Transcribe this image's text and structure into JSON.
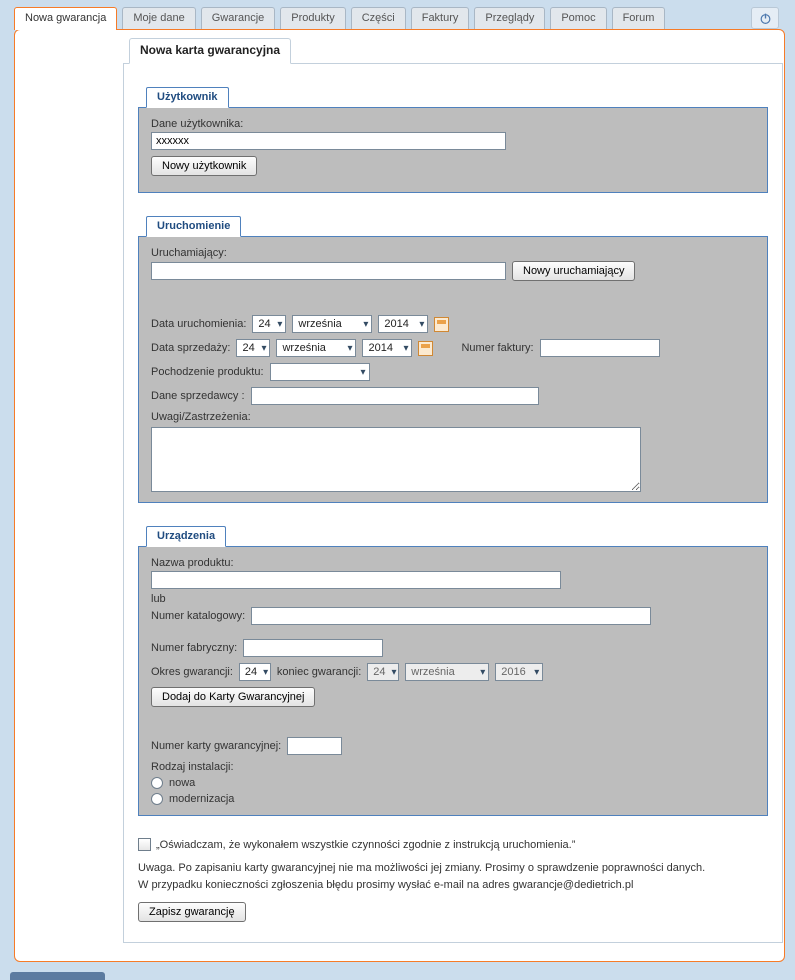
{
  "tabs": [
    {
      "label": "Nowa gwarancja"
    },
    {
      "label": "Moje dane"
    },
    {
      "label": "Gwarancje"
    },
    {
      "label": "Produkty"
    },
    {
      "label": "Części"
    },
    {
      "label": "Faktury"
    },
    {
      "label": "Przeglądy"
    },
    {
      "label": "Pomoc"
    },
    {
      "label": "Forum"
    }
  ],
  "page_title": "Nowa karta gwarancyjna",
  "user": {
    "legend": "Użytkownik",
    "data_label": "Dane użytkownika:",
    "data_value": "xxxxxx",
    "new_user_btn": "Nowy użytkownik"
  },
  "commissioning": {
    "legend": "Uruchomienie",
    "starter_label": "Uruchamiający:",
    "starter_value": "",
    "new_starter_btn": "Nowy uruchamiający",
    "run_date_label": "Data uruchomienia:",
    "sale_date_label": "Data sprzedaży:",
    "invoice_label": "Numer faktury:",
    "invoice_value": "",
    "origin_label": "Pochodzenie produktu:",
    "origin_value": "",
    "seller_label": "Dane sprzedawcy :",
    "seller_value": "",
    "remarks_label": "Uwagi/Zastrzeżenia:",
    "remarks_value": "",
    "date": {
      "day": "24",
      "month": "września",
      "year": "2014"
    },
    "sale_date": {
      "day": "24",
      "month": "września",
      "year": "2014"
    }
  },
  "devices": {
    "legend": "Urządzenia",
    "product_name_label": "Nazwa produktu:",
    "product_name_value": "",
    "or_label": "lub",
    "catalog_label": "Numer katalogowy:",
    "catalog_value": "",
    "serial_label": "Numer fabryczny:",
    "serial_value": "",
    "warranty_period_label": "Okres gwarancji:",
    "warranty_period_value": "24",
    "warranty_end_label": "koniec gwarancji:",
    "warranty_end": {
      "day": "24",
      "month": "września",
      "year": "2016"
    },
    "add_btn": "Dodaj do Karty Gwarancyjnej",
    "card_no_label": "Numer karty gwarancyjnej:",
    "card_no_value": "",
    "install_type_label": "Rodzaj instalacji:",
    "install_new": "nowa",
    "install_mod": "modernizacja"
  },
  "declaration": "„Oświadczam, że wykonałem wszystkie czynności zgodnie z instrukcją uruchomienia.”",
  "note_line1": "Uwaga. Po zapisaniu karty gwarancyjnej nie ma możliwości jej zmiany. Prosimy o sprawdzenie poprawności danych.",
  "note_line2": "W przypadku konieczności zgłoszenia błędu prosimy wysłać e-mail na adres gwarancje@dedietrich.pl",
  "save_btn": "Zapisz gwarancję"
}
